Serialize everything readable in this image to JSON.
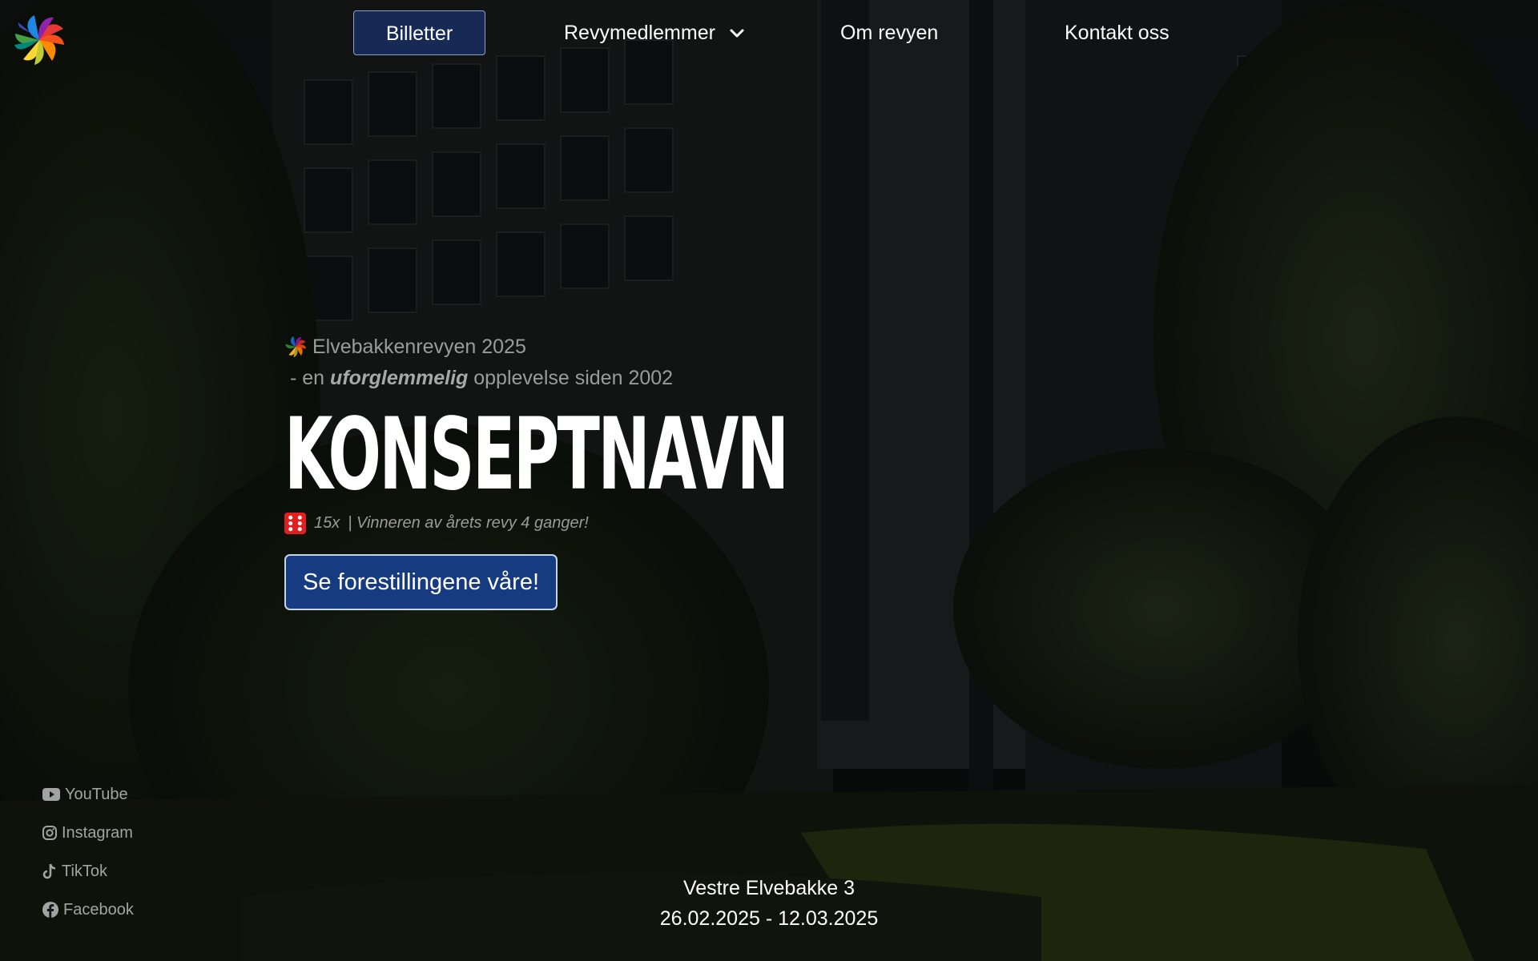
{
  "nav": {
    "logo_icon": "rainbow-swirl-logo",
    "items": [
      {
        "label": "Billetter",
        "active": true
      },
      {
        "label": "Revymedlemmer",
        "icon": "chevron-down-icon"
      },
      {
        "label": "Om revyen"
      },
      {
        "label": "Kontakt oss"
      }
    ]
  },
  "hero": {
    "kicker": "Elvebakkenrevyen 2025",
    "tagline_prefix": "- en",
    "tagline_emphasis": "uforglemmelig",
    "tagline_suffix": "opplevelse siden 2002",
    "headline": "KONSEPTNAVN",
    "award_icon": "dice-icon",
    "award_count": "15x",
    "award_text": "| Vinneren av årets revy 4 ganger!",
    "cta_label": "Se forestillingene våre!"
  },
  "socials": [
    {
      "label": "YouTube",
      "icon": "youtube-icon"
    },
    {
      "label": "Instagram",
      "icon": "instagram-icon"
    },
    {
      "label": "TikTok",
      "icon": "tiktok-icon"
    },
    {
      "label": "Facebook",
      "icon": "facebook-icon"
    }
  ],
  "info": {
    "address": "Vestre Elvebakke 3",
    "dates": "26.02.2025 - 12.03.2025"
  },
  "colors": {
    "accent_button": "#173b80",
    "nav_active": "#162a55",
    "background": "#0d0f0e",
    "muted_text": "#9b9b9b"
  }
}
